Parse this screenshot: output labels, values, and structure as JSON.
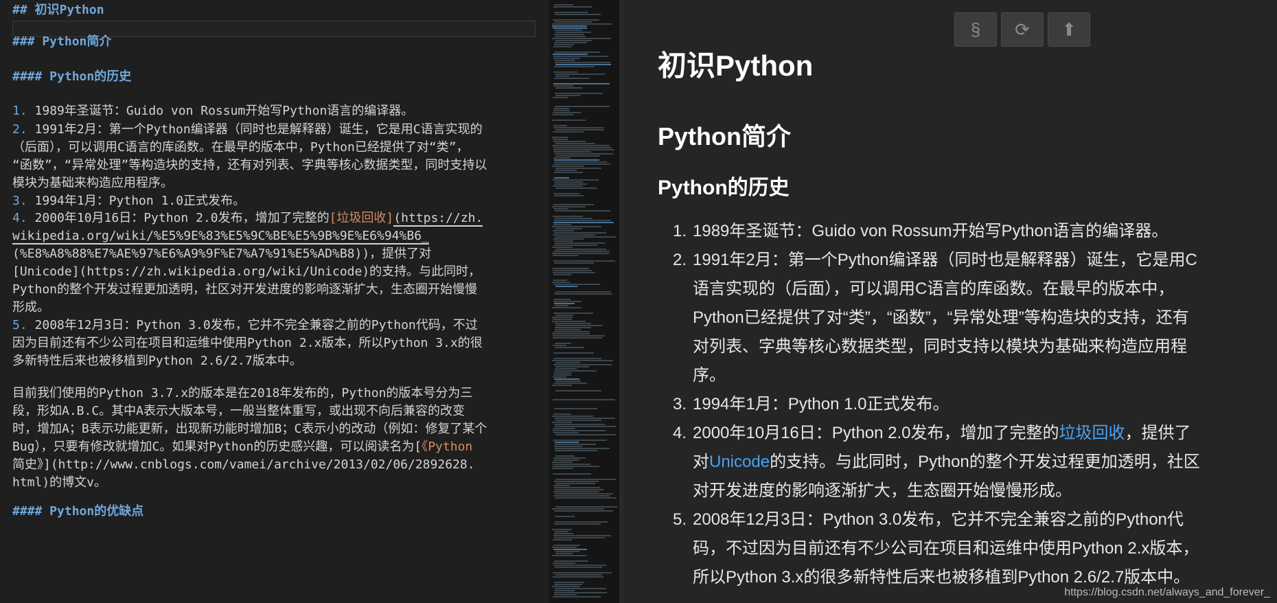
{
  "editor": {
    "lines": [
      {
        "cls": "h",
        "text": "## 初识Python"
      },
      {
        "cls": "h",
        "text": "### Python简介"
      },
      {
        "cls": "h",
        "text": "#### Python的历史"
      },
      {
        "n": "1.",
        "text": " 1989年圣诞节：Guido von Rossum开始写Python语言的编译器。"
      },
      {
        "n": "2.",
        "text": " 1991年2月：第一个Python编译器（同时也是解释器）诞生，它是用C语言实现的"
      },
      {
        "text": "（后面），可以调用C语言的库函数。在最早的版本中，Python已经提供了对“类”，"
      },
      {
        "text": "“函数”，“异常处理”等构造块的支持，还有对列表、字典等核心数据类型，同时支持以"
      },
      {
        "text": "模块为基础来构造应用程序。"
      },
      {
        "n": "3.",
        "text": " 1994年1月：Python 1.0正式发布。"
      },
      {
        "n": "4.",
        "text": " 2000年10月16日：Python 2.0发布，增加了完整的"
      },
      {
        "text": "wikipedia.org/wiki/%E5%9E%83%E5%9C%BE%E5%9B%9E%E6%94%B6_"
      },
      {
        "text": "(%E8%A8%88%E7%AE%97%E6%A9%9F%E7%A7%91%E5%AD%B8))，提供了对"
      },
      {
        "text": "[Unicode](https://zh.wikipedia.org/wiki/Unicode)的支持。与此同时，"
      },
      {
        "text": "Python的整个开发过程更加透明，社区对开发进度的影响逐渐扩大，生态圈开始慢慢"
      },
      {
        "text": "形成。"
      },
      {
        "n": "5.",
        "text": " 2008年12月3日：Python 3.0发布，它并不完全兼容之前的Python代码，不过"
      },
      {
        "text": "因为目前还有不少公司在项目和运维中使用Python 2.x版本，所以Python 3.x的很"
      },
      {
        "text": "多新特性后来也被移植到Python 2.6/2.7版本中。"
      },
      {
        "text": "目前我们使用的Python 3.7.x的版本是在2018年发布的，Python的版本号分为三"
      },
      {
        "text": "段，形如A.B.C。其中A表示大版本号，一般当整体重写，或出现不向后兼容的改变"
      },
      {
        "text": "时，增加A；B表示功能更新，出现新功能时增加B；C表示小的改动（例如：修复了某个"
      },
      {
        "text": "Bug），只要有修改就增加C。如果对Python的历史感兴趣，可以阅读名为["
      },
      {
        "text": "简史》](http://www.cnblogs.com/vamei/archive/2013/02/06/2892628."
      },
      {
        "text": "html)的博文v。"
      },
      {
        "cls": "h",
        "text": "#### Python的优缺点"
      }
    ],
    "l4_link": "[垃圾回收]",
    "l4_url": "(https://zh.",
    "l22_tail": "《Python"
  },
  "preview": {
    "h1": "初识Python",
    "h2": "Python简介",
    "h3": "Python的历史",
    "lines": [
      {
        "n": "1.",
        "text": "1989年圣诞节：Guido von Rossum开始写Python语言的编译器。"
      },
      {
        "n": "2.",
        "text": "1991年2月：第一个Python编译器（同时也是解释器）诞生，它是用C"
      },
      {
        "text": "语言实现的（后面），可以调用C语言的库函数。在最早的版本中，"
      },
      {
        "text": "Python已经提供了对“类”，“函数”，“异常处理”等构造块的支持，还有"
      },
      {
        "text": "对列表、字典等核心数据类型，同时支持以模块为基础来构造应用程"
      },
      {
        "text": "序。"
      },
      {
        "n": "3.",
        "text": "1994年1月：Python 1.0正式发布。"
      },
      {
        "n": "4.",
        "pre": "2000年10月16日：Python 2.0发布，增加了完整的",
        "link": "垃圾回收",
        "post": "，提供了"
      },
      {
        "pre": "对",
        "link": "Unicode",
        "post": "的支持。与此同时，Python的整个开发过程更加透明，社区"
      },
      {
        "text": "对开发进度的影响逐渐扩大，生态圈开始慢慢形成。"
      },
      {
        "n": "5.",
        "text": "2008年12月3日：Python 3.0发布，它并不完全兼容之前的Python代"
      },
      {
        "text": "码，不过因为目前还有不少公司在项目和运维中使用Python 2.x版本，"
      },
      {
        "text": "所以Python 3.x的很多新特性后来也被移植到Python 2.6/2.7版本中。"
      }
    ]
  },
  "toolbar": {
    "section_label": "§",
    "refresh_label": "⟳",
    "up_label": "⬆"
  },
  "watermark": "https://blog.csdn.net/always_and_forever_"
}
